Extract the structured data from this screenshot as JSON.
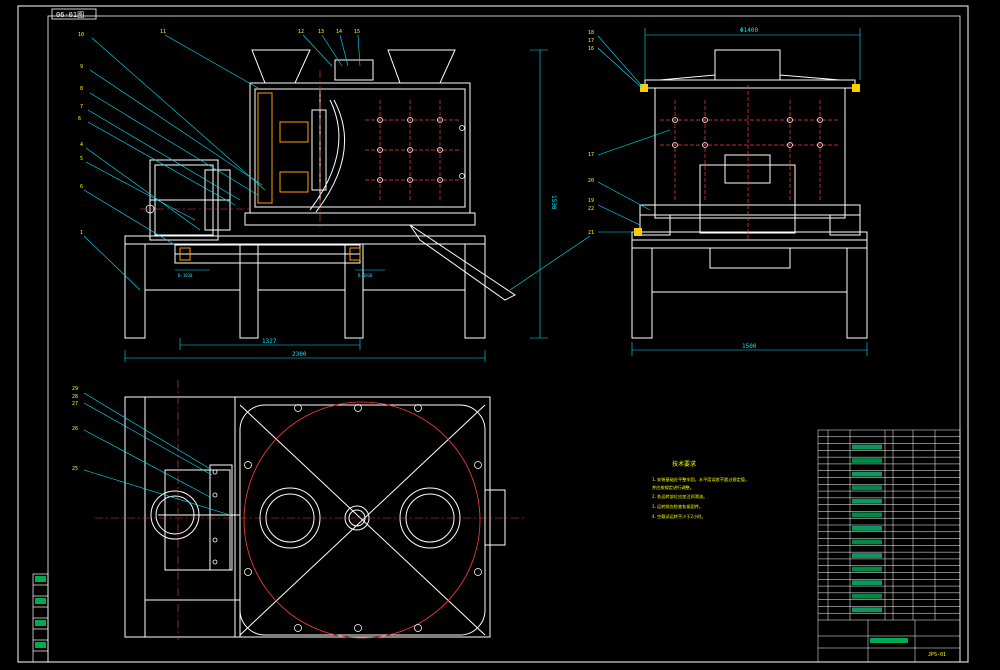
{
  "drawing_number_box": "06-01图",
  "title_block_bottom": "JPS-01",
  "dimensions": {
    "top_height": "1530",
    "overall_length": "2300",
    "wheelbase": "1327",
    "end_width_top": "Φ1400",
    "end_width_bottom": "1500",
    "belt_label_1": "B-1930",
    "belt_label_2": "B-1930"
  },
  "balloons_front": [
    "10",
    "9",
    "8",
    "7",
    "6",
    "5",
    "4",
    "3",
    "1",
    "11",
    "12",
    "13",
    "14",
    "15"
  ],
  "balloons_side": [
    "18",
    "17",
    "16",
    "17",
    "20",
    "19",
    "22",
    "21"
  ],
  "balloons_plan": [
    "29",
    "28",
    "27",
    "26",
    "25"
  ],
  "tech_requirements": {
    "title": "技术要求",
    "lines": [
      "1.安装基础应平整牢固，水平度误差不超过规定值，",
      "  并应按规定进行调整。",
      "2.各运转部位应加注润滑油。",
      "3.运转前应检查各紧固件。",
      "4.空载试运转不少于2小时。"
    ]
  },
  "colors": {
    "line": "#ffffff",
    "accent": "#ff3b3b",
    "dim": "#00e5ff",
    "balloon": "#ffff00",
    "frame": "#ffffff",
    "cut": "#ff00ff"
  }
}
